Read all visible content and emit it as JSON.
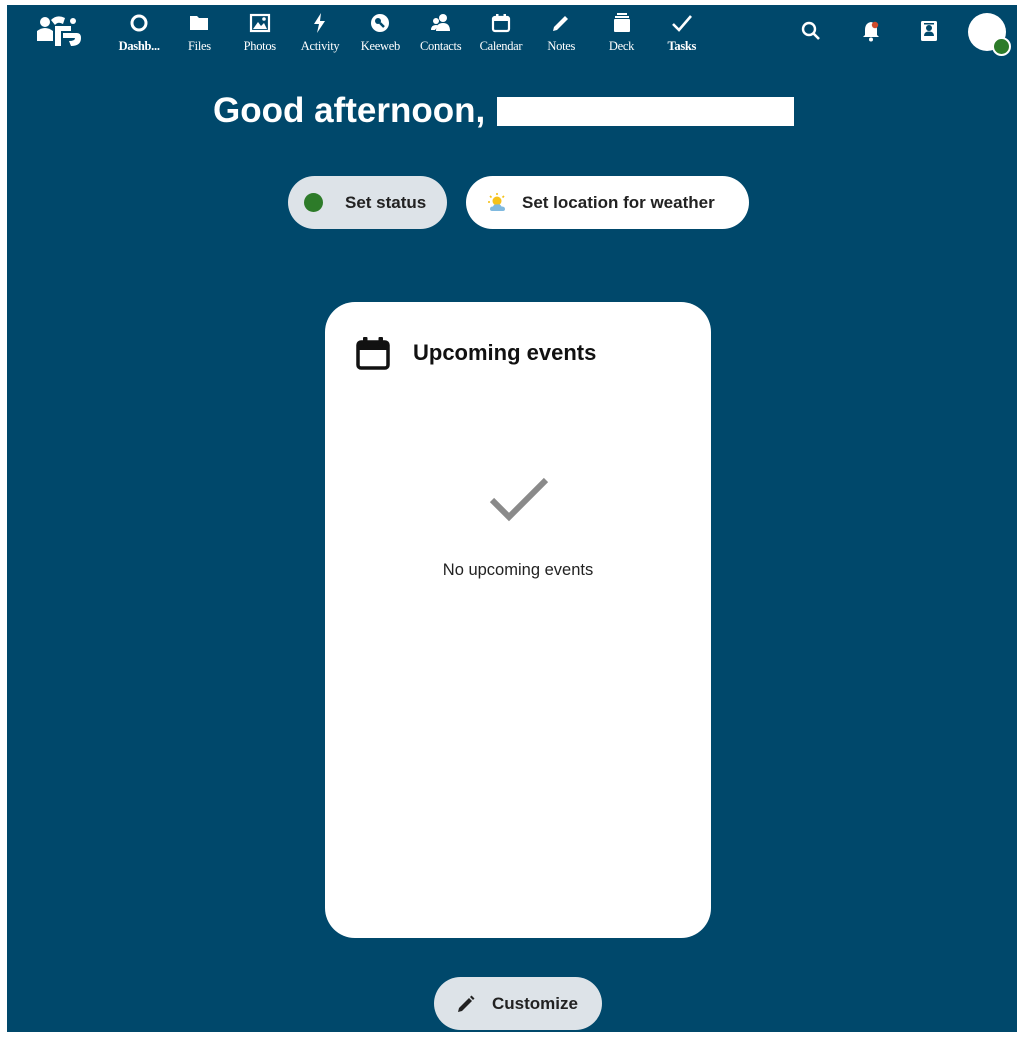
{
  "nav": {
    "items": [
      {
        "label": "Dashb...",
        "icon": "dashboard-icon"
      },
      {
        "label": "Files",
        "icon": "folder-icon"
      },
      {
        "label": "Photos",
        "icon": "image-icon"
      },
      {
        "label": "Activity",
        "icon": "lightning-icon"
      },
      {
        "label": "Keeweb",
        "icon": "key-icon"
      },
      {
        "label": "Contacts",
        "icon": "contacts-icon"
      },
      {
        "label": "Calendar",
        "icon": "calendar-icon"
      },
      {
        "label": "Notes",
        "icon": "pencil-icon"
      },
      {
        "label": "Deck",
        "icon": "deck-icon"
      },
      {
        "label": "Tasks",
        "icon": "check-icon"
      }
    ]
  },
  "header_actions": [
    "search-icon",
    "notifications-icon",
    "contacts-menu-icon",
    "avatar"
  ],
  "greeting": {
    "text": "Good afternoon,"
  },
  "status": {
    "set_status": "Set status",
    "set_weather": "Set location for weather"
  },
  "panel": {
    "title": "Upcoming events",
    "empty_text": "No upcoming events"
  },
  "customize": {
    "label": "Customize"
  },
  "colors": {
    "background": "#00486b",
    "status_online": "#2d7b29",
    "pill_grey": "#dde3e8"
  }
}
